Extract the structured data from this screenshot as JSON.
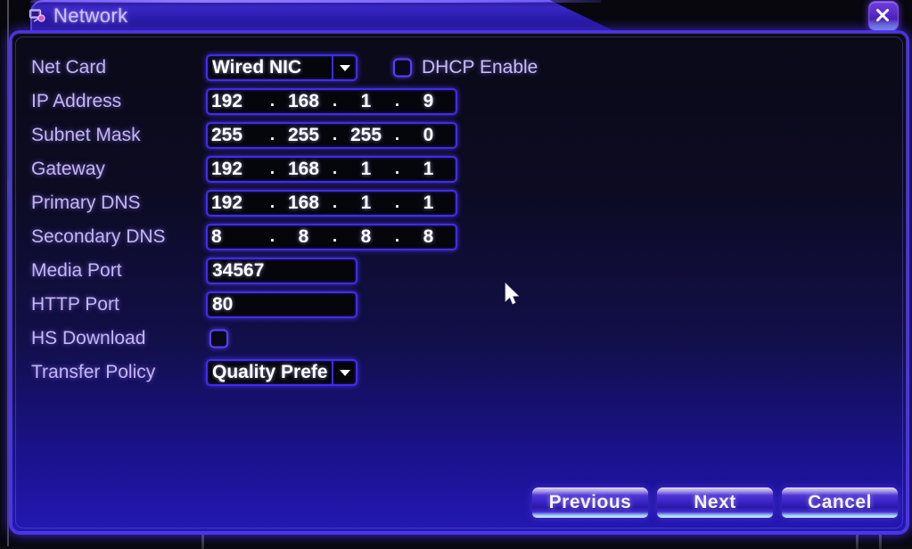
{
  "window": {
    "title": "Network",
    "title_icon": "network-card-icon",
    "close_icon": "close-icon"
  },
  "colors": {
    "accent_border": "#4b32ee",
    "field_border": "#3f2bf0",
    "label_text": "#c3b7f2",
    "value_text": "#ffffff",
    "panel_top": "#0a0a18",
    "panel_bottom": "#2418b4",
    "title_text": "#cfc4ff"
  },
  "form": {
    "net_card": {
      "label": "Net Card",
      "value": "Wired NIC",
      "options": [
        "Wired NIC"
      ],
      "caret_icon": "chevron-down-icon"
    },
    "dhcp": {
      "label": "DHCP Enable",
      "checked": false
    },
    "ip_address": {
      "label": "IP Address",
      "octets": [
        "192",
        "168",
        "1",
        "9"
      ]
    },
    "subnet_mask": {
      "label": "Subnet Mask",
      "octets": [
        "255",
        "255",
        "255",
        "0"
      ]
    },
    "gateway": {
      "label": "Gateway",
      "octets": [
        "192",
        "168",
        "1",
        "1"
      ]
    },
    "primary_dns": {
      "label": "Primary DNS",
      "octets": [
        "192",
        "168",
        "1",
        "1"
      ]
    },
    "secondary_dns": {
      "label": "Secondary DNS",
      "octets": [
        "8",
        "8",
        "8",
        "8"
      ]
    },
    "media_port": {
      "label": "Media Port",
      "value": "34567"
    },
    "http_port": {
      "label": "HTTP Port",
      "value": "80"
    },
    "hs_download": {
      "label": "HS Download",
      "checked": false
    },
    "transfer_policy": {
      "label": "Transfer Policy",
      "value": "Quality Prefe",
      "options": [
        "Quality Prefe"
      ],
      "caret_icon": "chevron-down-icon"
    },
    "separator": "."
  },
  "footer": {
    "previous_label": "Previous",
    "next_label": "Next",
    "cancel_label": "Cancel"
  },
  "pointer": {
    "icon": "mouse-arrow-cursor"
  }
}
